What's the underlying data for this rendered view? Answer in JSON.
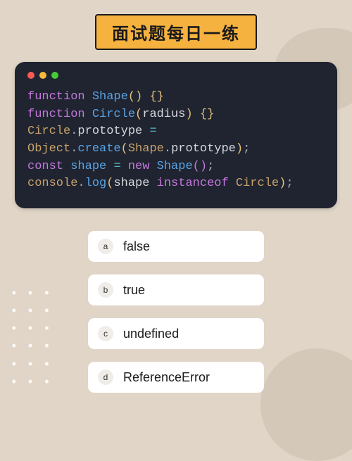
{
  "banner": {
    "title": "面试题每日一练"
  },
  "code": {
    "tokens": [
      {
        "c": "tok-kw",
        "t": "function"
      },
      {
        "c": "tok-id",
        "t": " "
      },
      {
        "c": "tok-fn",
        "t": "Shape"
      },
      {
        "c": "tok-p",
        "t": "()"
      },
      {
        "c": "tok-id",
        "t": " "
      },
      {
        "c": "tok-p",
        "t": "{}"
      },
      {
        "c": "",
        "t": "\n"
      },
      {
        "c": "tok-kw",
        "t": "function"
      },
      {
        "c": "tok-id",
        "t": " "
      },
      {
        "c": "tok-fn",
        "t": "Circle"
      },
      {
        "c": "tok-p",
        "t": "("
      },
      {
        "c": "tok-id",
        "t": "radius"
      },
      {
        "c": "tok-p",
        "t": ")"
      },
      {
        "c": "tok-id",
        "t": " "
      },
      {
        "c": "tok-p",
        "t": "{}"
      },
      {
        "c": "",
        "t": "\n"
      },
      {
        "c": "tok-obj",
        "t": "Circle"
      },
      {
        "c": "tok-s",
        "t": "."
      },
      {
        "c": "tok-prop",
        "t": "prototype"
      },
      {
        "c": "tok-id",
        "t": " "
      },
      {
        "c": "tok-op",
        "t": "="
      },
      {
        "c": "",
        "t": "\n"
      },
      {
        "c": "tok-obj",
        "t": "Object"
      },
      {
        "c": "tok-s",
        "t": "."
      },
      {
        "c": "tok-meth",
        "t": "create"
      },
      {
        "c": "tok-p",
        "t": "("
      },
      {
        "c": "tok-obj",
        "t": "Shape"
      },
      {
        "c": "tok-s",
        "t": "."
      },
      {
        "c": "tok-prop",
        "t": "prototype"
      },
      {
        "c": "tok-p",
        "t": ")"
      },
      {
        "c": "tok-s",
        "t": ";"
      },
      {
        "c": "",
        "t": "\n"
      },
      {
        "c": "tok-kw",
        "t": "const"
      },
      {
        "c": "tok-id",
        "t": " "
      },
      {
        "c": "tok-fn",
        "t": "shape"
      },
      {
        "c": "tok-id",
        "t": " "
      },
      {
        "c": "tok-op",
        "t": "="
      },
      {
        "c": "tok-id",
        "t": " "
      },
      {
        "c": "tok-kw",
        "t": "new"
      },
      {
        "c": "tok-id",
        "t": " "
      },
      {
        "c": "tok-fn",
        "t": "Shape"
      },
      {
        "c": "tok-p2",
        "t": "()"
      },
      {
        "c": "tok-s",
        "t": ";"
      },
      {
        "c": "",
        "t": "\n"
      },
      {
        "c": "tok-obj",
        "t": "console"
      },
      {
        "c": "tok-s",
        "t": "."
      },
      {
        "c": "tok-meth",
        "t": "log"
      },
      {
        "c": "tok-p",
        "t": "("
      },
      {
        "c": "tok-id",
        "t": "shape "
      },
      {
        "c": "tok-kw",
        "t": "instanceof"
      },
      {
        "c": "tok-id",
        "t": " "
      },
      {
        "c": "tok-obj",
        "t": "Circle"
      },
      {
        "c": "tok-p",
        "t": ")"
      },
      {
        "c": "tok-s",
        "t": ";"
      }
    ]
  },
  "options": [
    {
      "letter": "a",
      "label": "false"
    },
    {
      "letter": "b",
      "label": "true"
    },
    {
      "letter": "c",
      "label": "undefined"
    },
    {
      "letter": "d",
      "label": "ReferenceError"
    }
  ],
  "window_dots": [
    "red",
    "yellow",
    "green"
  ]
}
